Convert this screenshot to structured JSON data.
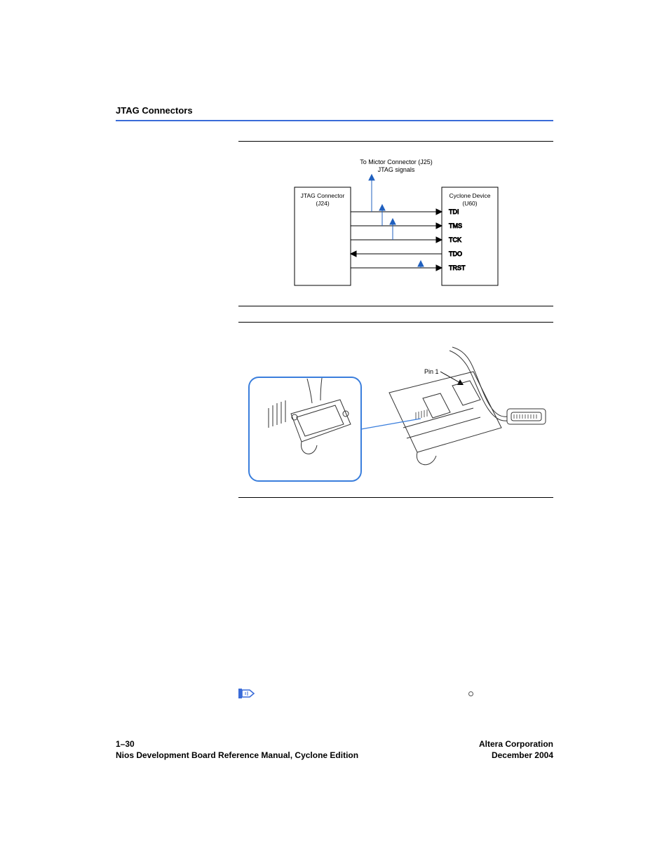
{
  "header": {
    "running": "JTAG Connectors"
  },
  "fig_top": {
    "top_label_l1": "To Mictor Connector (J25)",
    "top_label_l2": "JTAG signals",
    "left_box_l1": "JTAG Connector",
    "left_box_l2": "(J24)",
    "right_box_l1": "Cyclone Device",
    "right_box_l2": "(U60)",
    "sig1": "TDI",
    "sig2": "TMS",
    "sig3": "TCK",
    "sig4": "TDO",
    "sig5": "TRST"
  },
  "fig_bottom": {
    "pin_label": "Pin 1"
  },
  "footer": {
    "page_num": "1–30",
    "manual": "Nios Development Board Reference Manual, Cyclone Edition",
    "company": "Altera Corporation",
    "date": "December 2004"
  }
}
